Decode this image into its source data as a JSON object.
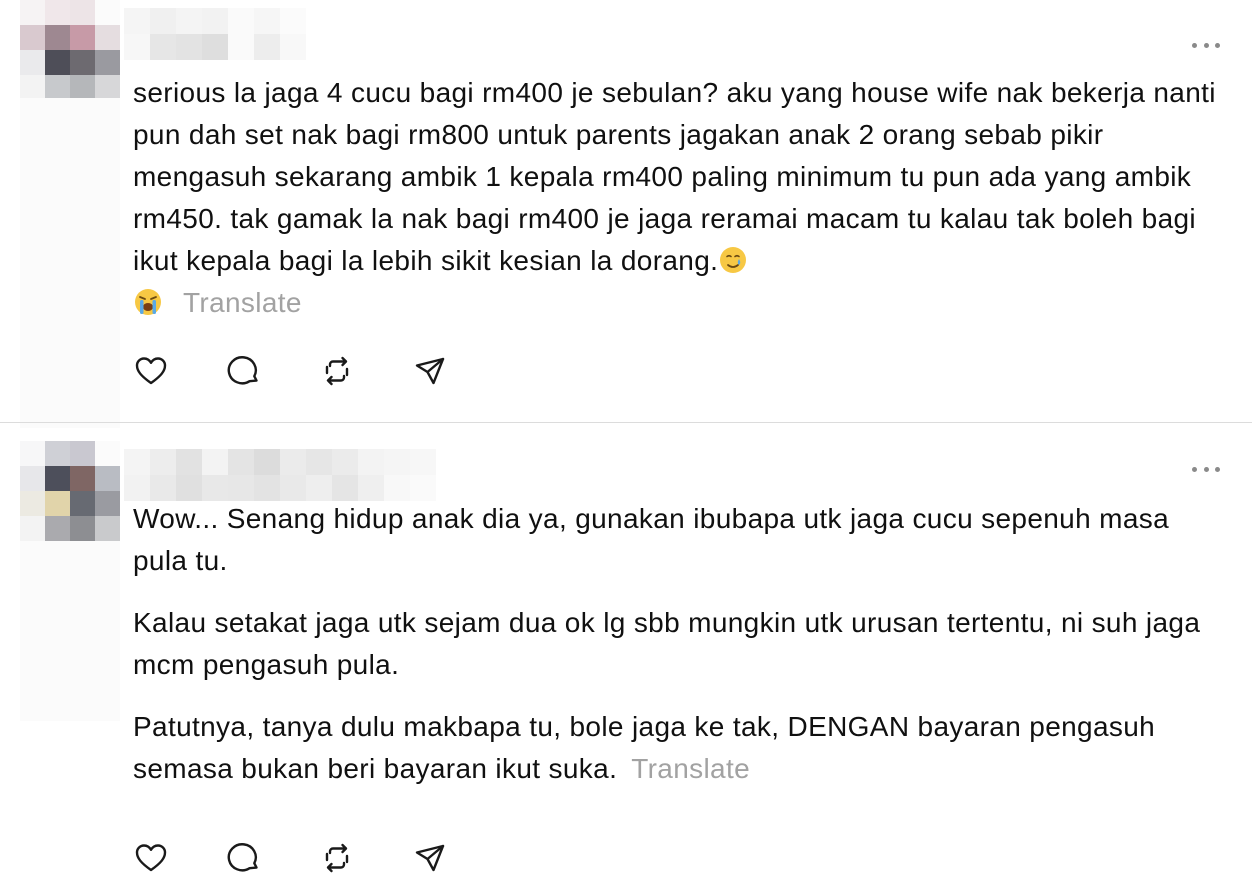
{
  "posts": [
    {
      "paragraphs": [
        "serious la jaga 4 cucu bagi rm400 je sebulan? aku yang house wife nak bekerja nanti pun dah set nak bagi rm800 untuk parents jagakan anak 2 orang sebab pikir mengasuh sekarang ambik 1 kepala rm400 paling minimum tu pun ada yang ambik rm450. tak gamak la nak bagi rm400 je jaga reramai macam tu kalau tak boleh bagi ikut kepala bagi la lebih sikit kesian la dorang."
      ],
      "translate_label": "Translate",
      "emojis": [
        "smiling-face-with-tear-emoji",
        "loudly-crying-face-emoji"
      ]
    },
    {
      "paragraphs": [
        "Wow... Senang hidup anak dia ya, gunakan ibubapa utk jaga cucu sepenuh masa pula tu.",
        "Kalau setakat jaga utk sejam dua ok lg sbb mungkin utk urusan tertentu, ni suh jaga mcm pengasuh pula.",
        "Patutnya, tanya dulu makbapa tu, bole jaga ke tak, DENGAN bayaran pengasuh semasa bukan beri bayaran ikut suka."
      ],
      "translate_label": "Translate"
    }
  ],
  "icons": {
    "like": "heart-icon",
    "reply": "comment-icon",
    "repost": "repost-icon",
    "share": "send-icon",
    "more": "more-options-icon"
  },
  "colors": {
    "text": "#101010",
    "translate": "#a2a2a2",
    "divider": "#dcdcdc",
    "icon": "#1a1a1a"
  }
}
